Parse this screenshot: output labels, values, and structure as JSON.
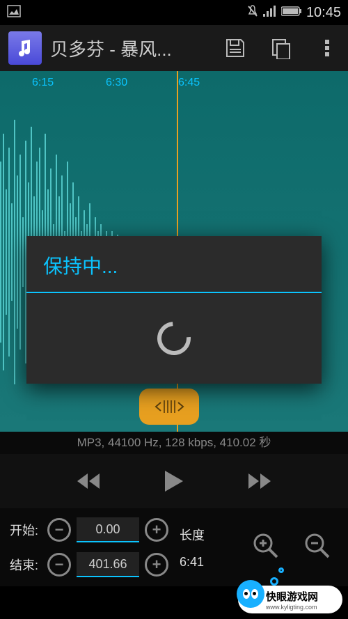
{
  "status_bar": {
    "time": "10:45"
  },
  "app_bar": {
    "title": "贝多芬 - 暴风..."
  },
  "waveform": {
    "markers": [
      "6:15",
      "6:30",
      "6:45"
    ]
  },
  "info_bar": {
    "text": "MP3, 44100 Hz, 128 kbps, 410.02 秒"
  },
  "edit": {
    "start_label": "开始:",
    "start_value": "0.00",
    "end_label": "结束:",
    "end_value": "401.66",
    "length_label": "长度",
    "length_value": "6:41"
  },
  "dialog": {
    "title": "保持中..."
  },
  "watermark": {
    "line1": "快眼游戏网",
    "line2": "www.kyligting.com"
  }
}
